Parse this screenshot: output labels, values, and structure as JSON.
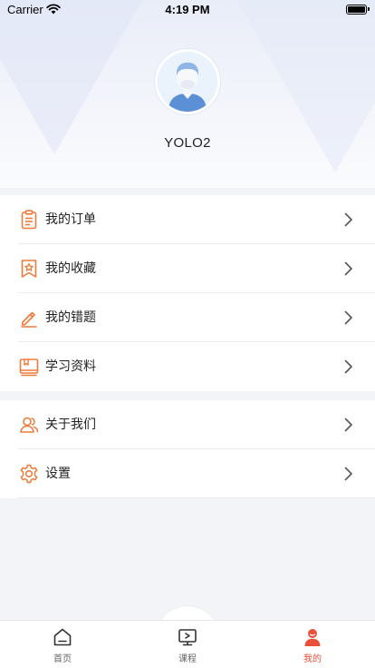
{
  "status_bar": {
    "carrier": "Carrier",
    "time": "4:19 PM"
  },
  "profile": {
    "username": "YOLO2"
  },
  "menu_group_1": [
    {
      "label": "我的订单",
      "icon": "clipboard-icon"
    },
    {
      "label": "我的收藏",
      "icon": "bookmark-star-icon"
    },
    {
      "label": "我的错题",
      "icon": "pencil-icon"
    },
    {
      "label": "学习资料",
      "icon": "book-icon"
    }
  ],
  "menu_group_2": [
    {
      "label": "关于我们",
      "icon": "users-icon"
    },
    {
      "label": "设置",
      "icon": "gear-icon"
    }
  ],
  "tab_bar": {
    "tabs": [
      {
        "label": "首页",
        "icon": "home-icon"
      },
      {
        "label": "课程",
        "icon": "play-screen-icon"
      },
      {
        "label": "我的",
        "icon": "user-icon"
      }
    ],
    "active": "我的"
  },
  "colors": {
    "accent": "#e8503a",
    "icon_orange": "#ee7a3b"
  }
}
